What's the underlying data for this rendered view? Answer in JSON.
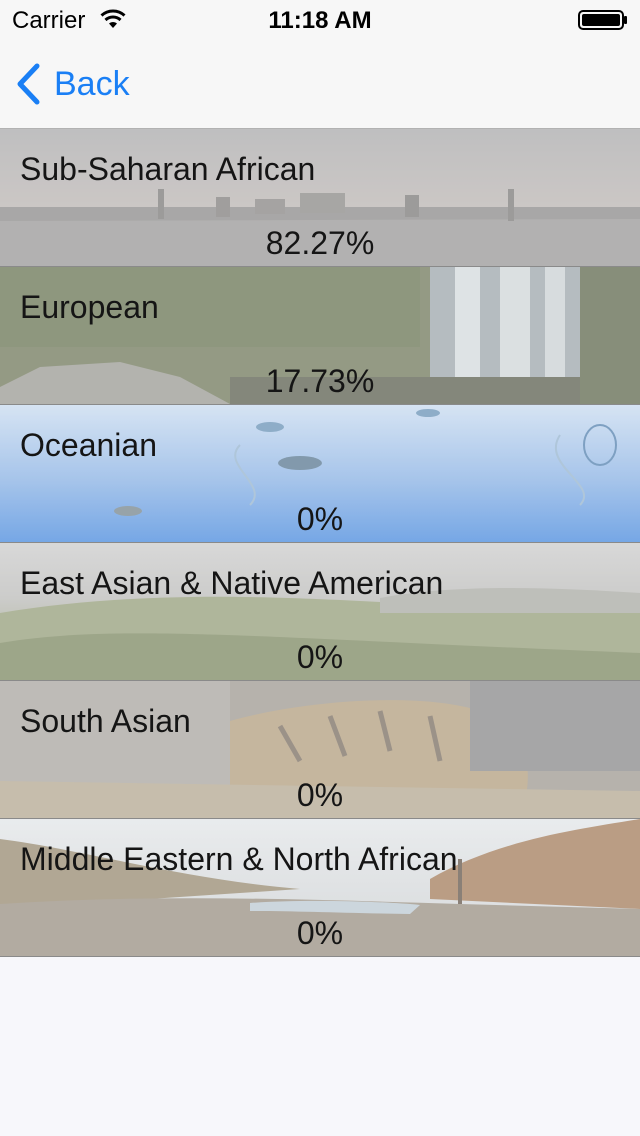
{
  "status_bar": {
    "carrier": "Carrier",
    "time": "11:18 AM",
    "icons": [
      "wifi-icon",
      "battery-icon"
    ]
  },
  "nav": {
    "back_label": "Back",
    "back_icon": "chevron-left-icon",
    "accent_color": "#1a7ff5"
  },
  "ancestry": [
    {
      "label": "Sub-Saharan African",
      "value": "82.27%"
    },
    {
      "label": "European",
      "value": "17.73%"
    },
    {
      "label": "Oceanian",
      "value": "0%"
    },
    {
      "label": "East Asian & Native American",
      "value": "0%"
    },
    {
      "label": "South Asian",
      "value": "0%"
    },
    {
      "label": "Middle Eastern & North African",
      "value": "0%"
    }
  ]
}
